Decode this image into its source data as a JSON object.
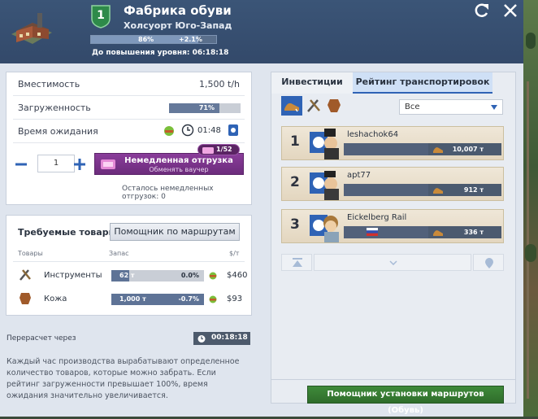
{
  "header": {
    "title": "Фабрика обуви",
    "location": "Холсуорт Юго-Запад",
    "level": "1",
    "xp_percent": "86%",
    "xp_progress": 0.86,
    "xp_bonus": "+2.1%",
    "levelup_label": "До повышения уровня:",
    "levelup_time": "06:18:18"
  },
  "stats": {
    "capacity_label": "Вместимость",
    "capacity_value": "1,500 t/h",
    "load_label": "Загруженность",
    "load_value": "71%",
    "load_progress": 0.71,
    "wait_label": "Время ожидания",
    "wait_time": "01:48",
    "quantity": "1",
    "instant_title": "Немедленная отгрузка",
    "instant_sub": "Обменять ваучер",
    "voucher_count": "1/52",
    "remaining_label": "Осталось немедленных отгрузок: 0"
  },
  "goods": {
    "title": "Требуемые товары",
    "helper_button": "Помощник по маршрутам",
    "col_goods": "Товары",
    "col_stock": "Запас",
    "col_price": "$/т",
    "items": [
      {
        "name": "Инструменты",
        "amount": "62 т",
        "percent": "0.0%",
        "price": "$460",
        "fill": 0.19
      },
      {
        "name": "Кожа",
        "amount": "1,000 т",
        "percent": "-0.7%",
        "price": "$93",
        "fill": 1.0
      }
    ]
  },
  "footer": {
    "recalc_label": "Перерасчет через",
    "recalc_time": "00:18:18",
    "info": "Каждый час производства вырабатывают определенное количество товаров, которые можно забрать. Если рейтинг загруженности превышает 100%, время ожидания значительно увеличивается."
  },
  "right": {
    "tab_invest": "Инвестиции",
    "tab_rating": "Рейтинг транспортировок",
    "filter_value": "Все",
    "ranking": [
      {
        "rank": "1",
        "name": "leshachok64",
        "amount": "10,007 т"
      },
      {
        "rank": "2",
        "name": "apt77",
        "amount": "912 т"
      },
      {
        "rank": "3",
        "name": "Eickelberg Rail",
        "amount": "336 т"
      }
    ],
    "route_button": "Помощник установки маршрутов (Обувь)"
  },
  "colors": {
    "header_bg": "#3b5577",
    "accent_purple": "#7a3489",
    "accent_green": "#3f8a3a",
    "tab_active": "#cfe0f6"
  }
}
